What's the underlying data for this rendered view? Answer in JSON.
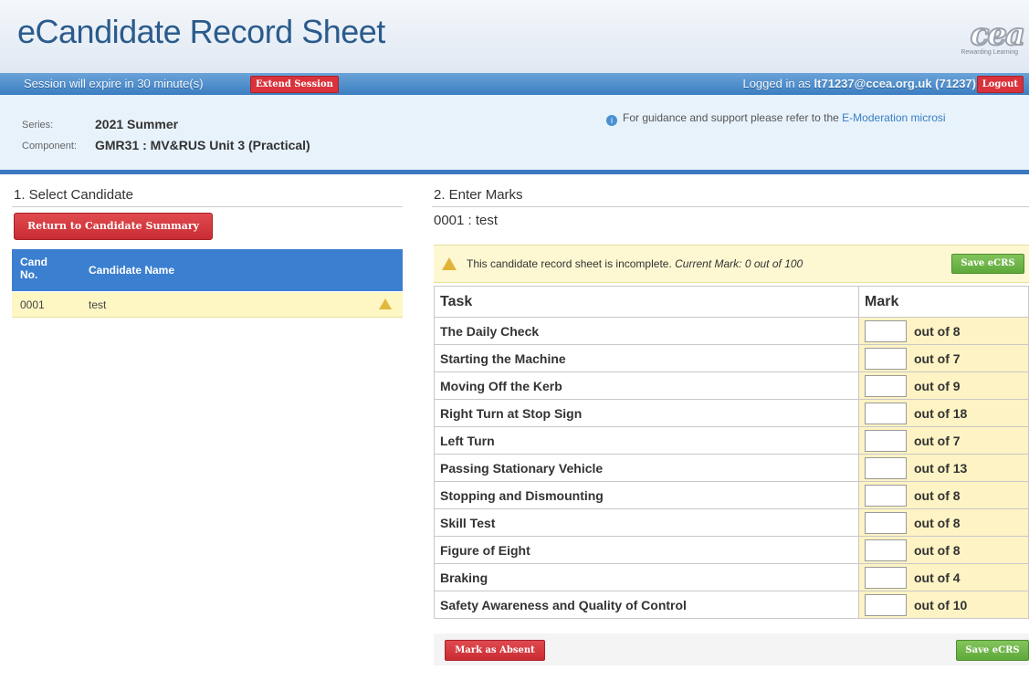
{
  "header": {
    "title": "eCandidate Record Sheet",
    "logo_text": "cea",
    "logo_tagline": "Rewarding Learning"
  },
  "session": {
    "expire_text": "Session will expire in 30 minute(s)",
    "extend_label": "Extend Session",
    "logged_prefix": "Logged in as",
    "logged_user": "lt71237@ccea.org.uk (71237)",
    "logout_label": "Logout"
  },
  "info": {
    "series_label": "Series:",
    "series_value": "2021 Summer",
    "component_label": "Component:",
    "component_value": "GMR31 : MV&RUS Unit 3 (Practical)",
    "guidance_text": "For guidance and support please refer to the",
    "guidance_link": "E-Moderation microsi"
  },
  "left": {
    "section_title": "1. Select Candidate",
    "return_label": "Return to Candidate Summary",
    "col_cand_no": [
      "Cand",
      "No."
    ],
    "col_name": "Candidate Name",
    "rows": [
      {
        "cand_no": "0001",
        "name": "test",
        "status_icon": "warning-icon"
      }
    ]
  },
  "right": {
    "section_title": "2. Enter Marks",
    "candidate": "0001 : test",
    "notice_text": "This candidate record sheet is incomplete.",
    "notice_current": "Current Mark: 0 out of 100",
    "save_label": "Save eCRS",
    "col_task": "Task",
    "col_mark": "Mark",
    "tasks": [
      {
        "task": "The Daily Check",
        "out_of": "out of 8",
        "value": ""
      },
      {
        "task": "Starting the Machine",
        "out_of": "out of 7",
        "value": ""
      },
      {
        "task": "Moving Off the Kerb",
        "out_of": "out of 9",
        "value": ""
      },
      {
        "task": "Right Turn at Stop Sign",
        "out_of": "out of 18",
        "value": ""
      },
      {
        "task": "Left Turn",
        "out_of": "out of 7",
        "value": ""
      },
      {
        "task": "Passing Stationary Vehicle",
        "out_of": "out of 13",
        "value": ""
      },
      {
        "task": "Stopping and Dismounting",
        "out_of": "out of 8",
        "value": ""
      },
      {
        "task": "Skill Test",
        "out_of": "out of 8",
        "value": ""
      },
      {
        "task": "Figure of Eight",
        "out_of": "out of 8",
        "value": ""
      },
      {
        "task": "Braking",
        "out_of": "out of 4",
        "value": ""
      },
      {
        "task": "Safety Awareness and Quality of Control",
        "out_of": "out of 10",
        "value": ""
      }
    ],
    "absent_label": "Mark as Absent"
  }
}
